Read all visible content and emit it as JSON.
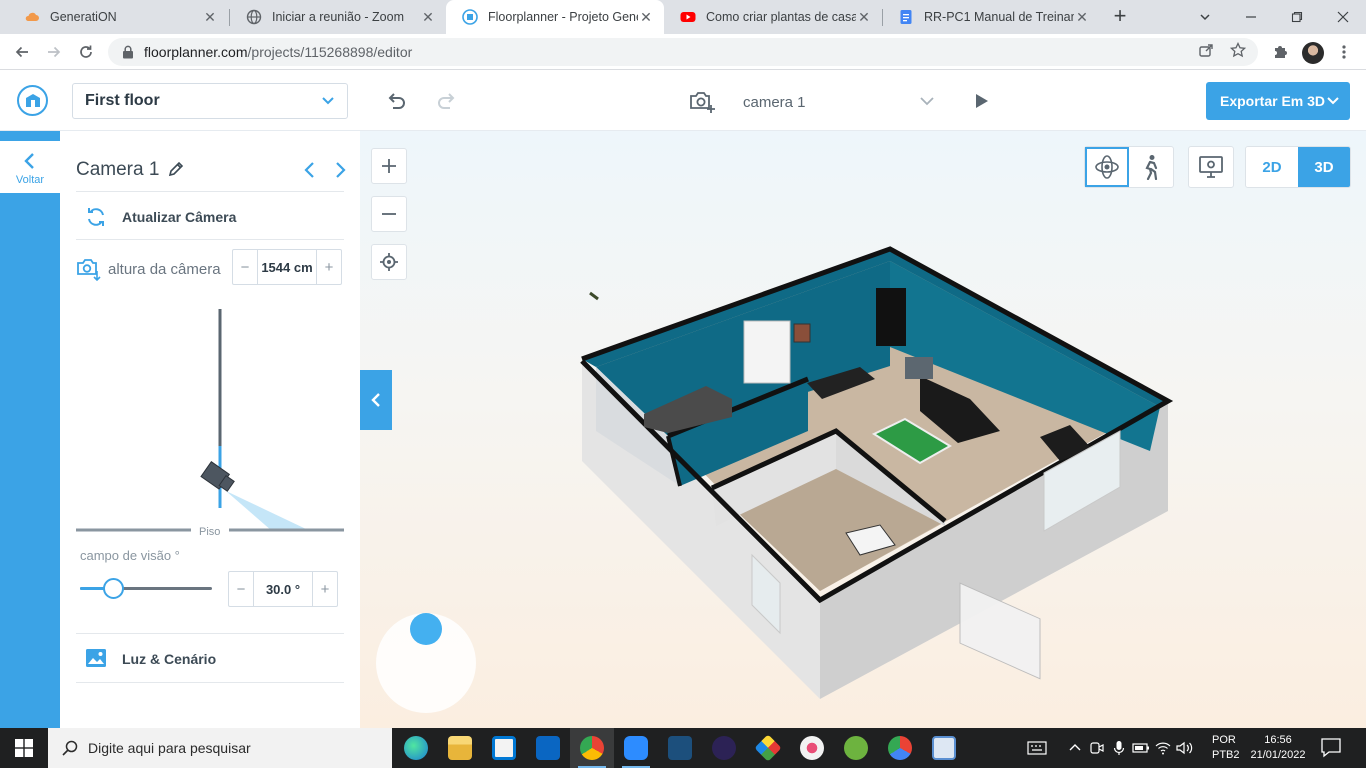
{
  "browser": {
    "tabs": [
      {
        "title": "GeneratiON",
        "favicon": "cloud-orange-icon",
        "active": false
      },
      {
        "title": "Iniciar a reunião - Zoom",
        "favicon": "globe-icon",
        "active": false
      },
      {
        "title": "Floorplanner - Projeto Generat",
        "favicon": "floorplanner-icon",
        "active": true
      },
      {
        "title": "Como criar plantas de casas no",
        "favicon": "youtube-icon",
        "active": false
      },
      {
        "title": "RR-PC1 Manual de Treinamento",
        "favicon": "docs-icon",
        "active": false
      }
    ],
    "url_host": "floorplanner.com",
    "url_path": "/projects/115268898/editor"
  },
  "app": {
    "floor_select": "First floor",
    "camera_select": "camera 1",
    "export_label": "Exportar Em 3D"
  },
  "rail": {
    "back_label": "Voltar"
  },
  "panel": {
    "title": "Camera 1",
    "refresh_label": "Atualizar Câmera",
    "height_label": "altura da câmera",
    "height_value": "1544 cm",
    "floor_label": "Piso",
    "fov_label": "campo de visão °",
    "fov_value": "30.0 °",
    "light_label": "Luz & Cenário"
  },
  "viewport": {
    "dim_2d_label": "2D",
    "dim_3d_label": "3D",
    "active_view": "3D",
    "navigation_mode": "orbit"
  },
  "taskbar": {
    "search_placeholder": "Digite aqui para pesquisar",
    "lang_top": "POR",
    "lang_bottom": "PTB2",
    "time": "16:56",
    "date": "21/01/2022"
  },
  "colors": {
    "accent": "#3ba3e6",
    "wall": "#0f6a86"
  }
}
